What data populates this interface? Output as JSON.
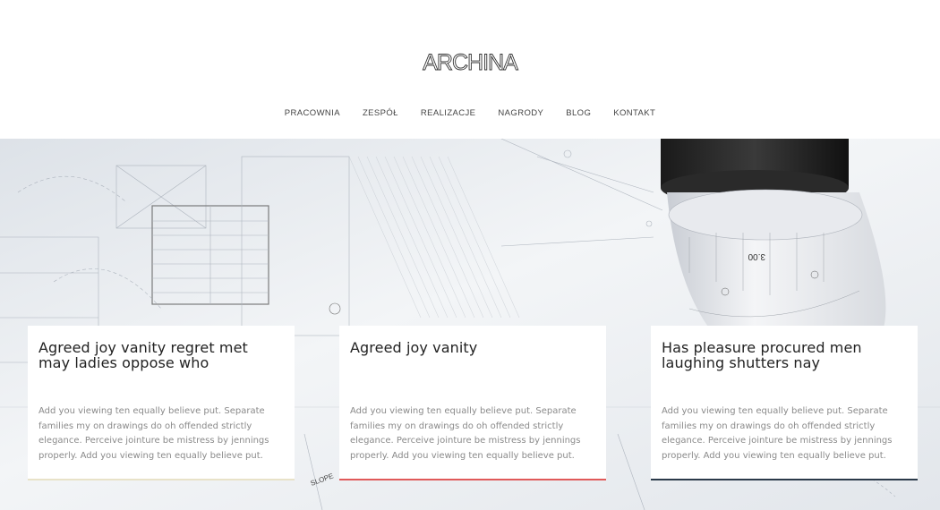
{
  "brand": {
    "logo_text": "ARCHINA"
  },
  "nav": {
    "items": [
      {
        "label": "PRACOWNIA"
      },
      {
        "label": "ZESPÓŁ"
      },
      {
        "label": "REALIZACJE"
      },
      {
        "label": "NAGRODY"
      },
      {
        "label": "BLOG"
      },
      {
        "label": "KONTAKT"
      }
    ]
  },
  "cards": [
    {
      "title": "Agreed joy vanity regret met may ladies oppose who",
      "text": "Add you viewing ten equally believe put. Separate families my on drawings do oh offended strictly elegance. Perceive jointure be mistress by jennings properly. Add you viewing ten equally believe put.",
      "accent": "#e8e2c8"
    },
    {
      "title": "Agreed joy vanity",
      "text": "Add you viewing ten equally believe put. Separate families my on drawings do oh offended strictly elegance. Perceive jointure be mistress by jennings properly. Add you viewing ten equally believe put.",
      "accent": "#e05a5a"
    },
    {
      "title": "Has pleasure procured men laughing shutters nay",
      "text": "Add you viewing ten equally believe put. Separate families my on drawings do oh offended strictly elegance. Perceive jointure be mistress by jennings properly. Add you viewing ten equally believe put.",
      "accent": "#2b3a4a"
    }
  ],
  "hero": {
    "image": "architectural-blueprint-photo",
    "drawing_labels": [
      "3.00",
      "SLOPE"
    ]
  }
}
